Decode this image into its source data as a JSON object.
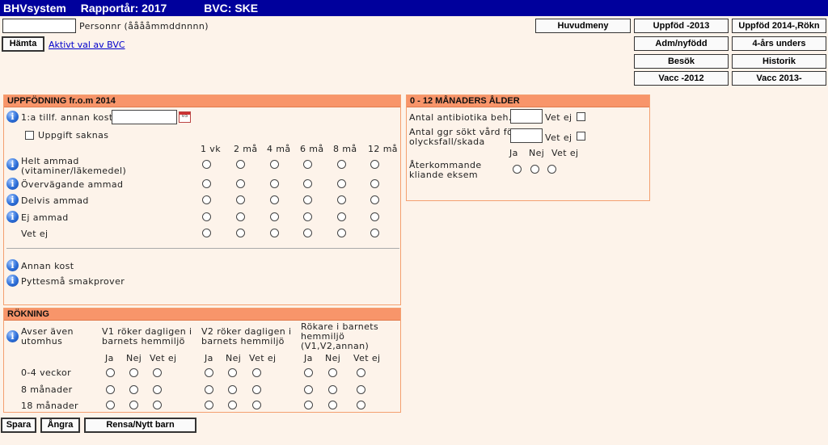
{
  "header": {
    "app": "BHVsystem",
    "year": "Rapportår: 2017",
    "bvc": "BVC: SKE"
  },
  "search": {
    "personnr_value": "",
    "personnr_label": "Personnr (ååååmmddnnnn)",
    "fetch_label": "Hämta",
    "active_link": "Aktivt val av BVC"
  },
  "nav": {
    "huvudmeny": "Huvudmeny",
    "uppfod2013": "Uppföd -2013",
    "uppfod2014": "Uppföd 2014-,Rökn",
    "admnyfodd": "Adm/nyfödd",
    "fyraars": "4-års unders",
    "besok": "Besök",
    "historik": "Historik",
    "vacc2012": "Vacc -2012",
    "vacc2013": "Vacc 2013-"
  },
  "feeding": {
    "title": "UPPFÖDNING fr.o.m 2014",
    "first_other_food": "1:a tillf. annan kost",
    "no_info": "Uppgift saknas",
    "calendar_text": "05",
    "columns": [
      "1 vk",
      "2 må",
      "4 må",
      "6 må",
      "8 må",
      "12 må"
    ],
    "rows": [
      "Helt ammad",
      "Övervägande ammad",
      "Delvis ammad",
      "Ej ammad",
      "Vet ej"
    ],
    "row0_sub": "(vitaminer/läkemedel)",
    "other_food": "Annan kost",
    "tastings": "Pyttesmå smakprover"
  },
  "infancy": {
    "title": "0 - 12 MÅNADERS ÅLDER",
    "antibiotics": "Antal antibiotika beh.",
    "injury_l1": "Antal ggr sökt vård för",
    "injury_l2": "olycksfall/skada",
    "unknown": "Vet ej",
    "eczema_l1": "Återkommande",
    "eczema_l2": "kliande eksem",
    "yes": "Ja",
    "no": "Nej",
    "dont_know": "Vet ej"
  },
  "smoking": {
    "title": "RÖKNING",
    "outdoor_l1": "Avser även",
    "outdoor_l2": "utomhus",
    "v1_l1": "V1 röker dagligen i",
    "v1_l2": "barnets hemmiljö",
    "v2_l1": "V2 röker dagligen i",
    "v2_l2": "barnets hemmiljö",
    "smokers_l1": "Rökare i barnets",
    "smokers_l2": "hemmiljö",
    "smokers_l3": "(V1,V2,annan)",
    "yes": "Ja",
    "no": "Nej",
    "dont_know": "Vet ej",
    "rows": [
      "0-4 veckor",
      "8 månader",
      "18 månader"
    ]
  },
  "footer": {
    "save": "Spara",
    "undo": "Ångra",
    "clear": "Rensa/Nytt barn"
  },
  "colors": {
    "titlebar": "#00009c",
    "section_header": "#f8956a",
    "section_border": "#f4a070",
    "background": "#fdf3ea"
  },
  "icons": [
    "info-icon",
    "calendar-icon"
  ]
}
